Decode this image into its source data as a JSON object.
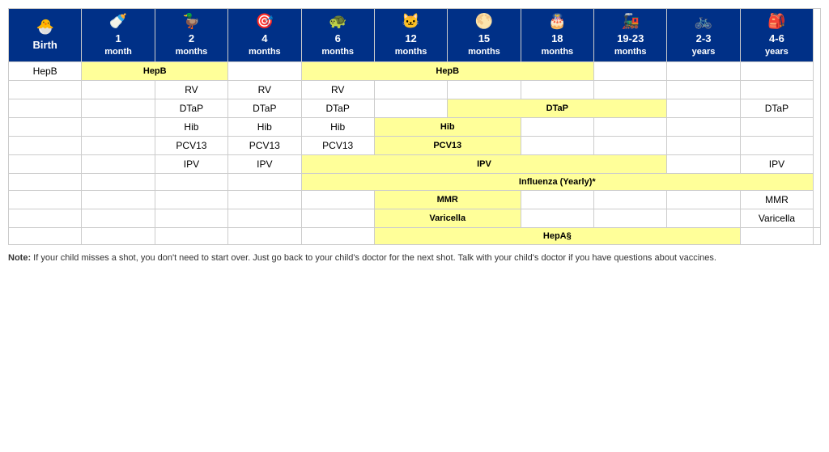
{
  "header": {
    "columns": [
      {
        "id": "birth",
        "icon": "🐣",
        "line1": "Birth",
        "line2": ""
      },
      {
        "id": "1mo",
        "icon": "🍼",
        "line1": "1",
        "line2": "month"
      },
      {
        "id": "2mo",
        "icon": "🦆",
        "line1": "2",
        "line2": "months"
      },
      {
        "id": "4mo",
        "icon": "🎯",
        "line1": "4",
        "line2": "months"
      },
      {
        "id": "6mo",
        "icon": "🐢",
        "line1": "6",
        "line2": "months"
      },
      {
        "id": "12mo",
        "icon": "🐱",
        "line1": "12",
        "line2": "months"
      },
      {
        "id": "15mo",
        "icon": "🌕",
        "line1": "15",
        "line2": "months"
      },
      {
        "id": "18mo",
        "icon": "🎂",
        "line1": "18",
        "line2": "months"
      },
      {
        "id": "1923mo",
        "icon": "🚂",
        "line1": "19-23",
        "line2": "months"
      },
      {
        "id": "23yr",
        "icon": "🚲",
        "line1": "2-3",
        "line2": "years"
      },
      {
        "id": "46yr",
        "icon": "🎒",
        "line1": "4-6",
        "line2": "years"
      }
    ]
  },
  "rows": [
    {
      "name": "HepB",
      "cells": [
        {
          "type": "empty"
        },
        {
          "type": "yellow",
          "colspan": 2,
          "text": "HepB"
        },
        {
          "type": "empty"
        },
        {
          "type": "yellow",
          "colspan": 4,
          "text": "HepB"
        },
        {
          "type": "empty"
        },
        {
          "type": "empty"
        },
        {
          "type": "empty"
        }
      ]
    },
    {
      "name": "",
      "cells": [
        {
          "type": "empty"
        },
        {
          "type": "empty"
        },
        {
          "type": "plain",
          "text": "RV"
        },
        {
          "type": "plain",
          "text": "RV"
        },
        {
          "type": "plain",
          "text": "RV"
        },
        {
          "type": "empty"
        },
        {
          "type": "empty"
        },
        {
          "type": "empty"
        },
        {
          "type": "empty"
        },
        {
          "type": "empty"
        },
        {
          "type": "empty"
        }
      ]
    },
    {
      "name": "",
      "cells": [
        {
          "type": "empty"
        },
        {
          "type": "empty"
        },
        {
          "type": "plain",
          "text": "DTaP"
        },
        {
          "type": "plain",
          "text": "DTaP"
        },
        {
          "type": "plain",
          "text": "DTaP"
        },
        {
          "type": "empty"
        },
        {
          "type": "yellow",
          "colspan": 3,
          "text": "DTaP"
        },
        {
          "type": "empty"
        },
        {
          "type": "plain",
          "text": "DTaP"
        }
      ]
    },
    {
      "name": "",
      "cells": [
        {
          "type": "empty"
        },
        {
          "type": "empty"
        },
        {
          "type": "plain",
          "text": "Hib"
        },
        {
          "type": "plain",
          "text": "Hib"
        },
        {
          "type": "plain",
          "text": "Hib"
        },
        {
          "type": "yellow",
          "colspan": 2,
          "text": "Hib"
        },
        {
          "type": "empty"
        },
        {
          "type": "empty"
        },
        {
          "type": "empty"
        },
        {
          "type": "empty"
        }
      ]
    },
    {
      "name": "",
      "cells": [
        {
          "type": "empty"
        },
        {
          "type": "empty"
        },
        {
          "type": "plain",
          "text": "PCV13"
        },
        {
          "type": "plain",
          "text": "PCV13"
        },
        {
          "type": "plain",
          "text": "PCV13"
        },
        {
          "type": "yellow",
          "colspan": 2,
          "text": "PCV13"
        },
        {
          "type": "empty"
        },
        {
          "type": "empty"
        },
        {
          "type": "empty"
        },
        {
          "type": "empty"
        }
      ]
    },
    {
      "name": "",
      "cells": [
        {
          "type": "empty"
        },
        {
          "type": "empty"
        },
        {
          "type": "plain",
          "text": "IPV"
        },
        {
          "type": "plain",
          "text": "IPV"
        },
        {
          "type": "yellow",
          "colspan": 5,
          "text": "IPV"
        },
        {
          "type": "empty"
        },
        {
          "type": "plain",
          "text": "IPV"
        }
      ]
    },
    {
      "name": "",
      "cells": [
        {
          "type": "empty"
        },
        {
          "type": "empty"
        },
        {
          "type": "empty"
        },
        {
          "type": "empty"
        },
        {
          "type": "yellow",
          "colspan": 7,
          "text": "Influenza (Yearly)*"
        }
      ]
    },
    {
      "name": "",
      "cells": [
        {
          "type": "empty"
        },
        {
          "type": "empty"
        },
        {
          "type": "empty"
        },
        {
          "type": "empty"
        },
        {
          "type": "empty"
        },
        {
          "type": "yellow",
          "colspan": 2,
          "text": "MMR"
        },
        {
          "type": "empty"
        },
        {
          "type": "empty"
        },
        {
          "type": "empty"
        },
        {
          "type": "plain",
          "text": "MMR"
        }
      ]
    },
    {
      "name": "",
      "cells": [
        {
          "type": "empty"
        },
        {
          "type": "empty"
        },
        {
          "type": "empty"
        },
        {
          "type": "empty"
        },
        {
          "type": "empty"
        },
        {
          "type": "yellow",
          "colspan": 2,
          "text": "Varicella"
        },
        {
          "type": "empty"
        },
        {
          "type": "empty"
        },
        {
          "type": "empty"
        },
        {
          "type": "plain",
          "text": "Varicella"
        }
      ]
    },
    {
      "name": "",
      "cells": [
        {
          "type": "empty"
        },
        {
          "type": "empty"
        },
        {
          "type": "empty"
        },
        {
          "type": "empty"
        },
        {
          "type": "empty"
        },
        {
          "type": "yellow",
          "colspan": 5,
          "text": "HepA§"
        },
        {
          "type": "empty"
        },
        {
          "type": "empty"
        }
      ]
    }
  ],
  "vaccine_names": [
    "HepB",
    "",
    "",
    "",
    "",
    "",
    "",
    "",
    "",
    ""
  ],
  "note": "Note: If your child misses a shot, you don't need to start over. Just go back to your child's doctor for the next shot. Talk with your child's doctor if you have questions about vaccines."
}
